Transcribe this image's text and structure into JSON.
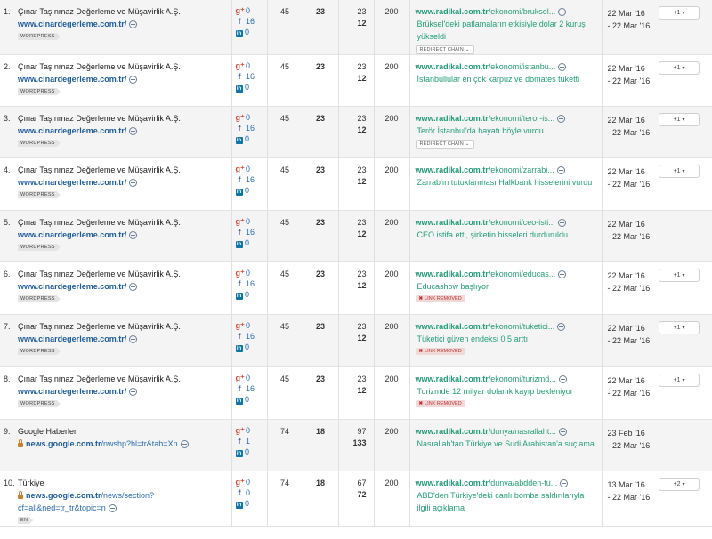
{
  "rows": [
    {
      "num": "1.",
      "title": "Çınar Taşınmaz Değerleme ve Müşavirlik A.Ş.",
      "domain": "www.cinardegerleme.com.tr/",
      "path": "",
      "tag": "WORDPRESS",
      "lock": false,
      "gplus": "0",
      "fb": "16",
      "li": "0",
      "n1": "45",
      "n2": "23",
      "n3a": "23",
      "n3b": "12",
      "code": "200",
      "tdomain": "www.radikal.com.tr",
      "tpath": "/ekonomi/bruksel...",
      "anchor": "Brüksel'deki patlamaların etkisiyle dolar 2 kuruş yükseldi",
      "chip": "REDIRECT CHAIN",
      "chip_arrow": "⌄",
      "removed": "",
      "date1": "22 Mar '16",
      "date2": "- 22 Mar '16",
      "vote": "+1"
    },
    {
      "num": "2.",
      "title": "Çınar Taşınmaz Değerleme ve Müşavirlik A.Ş.",
      "domain": "www.cinardegerleme.com.tr/",
      "path": "",
      "tag": "WORDPRESS",
      "lock": false,
      "gplus": "0",
      "fb": "16",
      "li": "0",
      "n1": "45",
      "n2": "23",
      "n3a": "23",
      "n3b": "12",
      "code": "200",
      "tdomain": "www.radikal.com.tr",
      "tpath": "/ekonomi/istanbu...",
      "anchor": "İstanbullular en çok karpuz ve domates tüketti",
      "chip": "",
      "removed": "",
      "date1": "22 Mar '16",
      "date2": "- 22 Mar '16",
      "vote": "+1"
    },
    {
      "num": "3.",
      "title": "Çınar Taşınmaz Değerleme ve Müşavirlik A.Ş.",
      "domain": "www.cinardegerleme.com.tr/",
      "path": "",
      "tag": "WORDPRESS",
      "lock": false,
      "gplus": "0",
      "fb": "16",
      "li": "0",
      "n1": "45",
      "n2": "23",
      "n3a": "23",
      "n3b": "12",
      "code": "200",
      "tdomain": "www.radikal.com.tr",
      "tpath": "/ekonomi/teror-is...",
      "anchor": "Terör İstanbul'da hayatı böyle vurdu",
      "chip": "REDIRECT CHAIN",
      "chip_arrow": "⌄",
      "removed": "",
      "date1": "22 Mar '16",
      "date2": "- 22 Mar '16",
      "vote": "+1"
    },
    {
      "num": "4.",
      "title": "Çınar Taşınmaz Değerleme ve Müşavirlik A.Ş.",
      "domain": "www.cinardegerleme.com.tr/",
      "path": "",
      "tag": "WORDPRESS",
      "lock": false,
      "gplus": "0",
      "fb": "16",
      "li": "0",
      "n1": "45",
      "n2": "23",
      "n3a": "23",
      "n3b": "12",
      "code": "200",
      "tdomain": "www.radikal.com.tr",
      "tpath": "/ekonomi/zarrabi...",
      "anchor": "Zarrab'ın tutuklanması Halkbank hisselerini vurdu",
      "chip": "",
      "removed": "",
      "date1": "22 Mar '16",
      "date2": "- 22 Mar '16",
      "vote": "+1"
    },
    {
      "num": "5.",
      "title": "Çınar Taşınmaz Değerleme ve Müşavirlik A.Ş.",
      "domain": "www.cinardegerleme.com.tr/",
      "path": "",
      "tag": "WORDPRESS",
      "lock": false,
      "gplus": "0",
      "fb": "16",
      "li": "0",
      "n1": "45",
      "n2": "23",
      "n3a": "23",
      "n3b": "12",
      "code": "200",
      "tdomain": "www.radikal.com.tr",
      "tpath": "/ekonomi/ceo-isti...",
      "anchor": "CEO istifa etti, şirketin hisseleri durduruldu",
      "chip": "",
      "removed": "",
      "date1": "22 Mar '16",
      "date2": "- 22 Mar '16",
      "vote": ""
    },
    {
      "num": "6.",
      "title": "Çınar Taşınmaz Değerleme ve Müşavirlik A.Ş.",
      "domain": "www.cinardegerleme.com.tr/",
      "path": "",
      "tag": "WORDPRESS",
      "lock": false,
      "gplus": "0",
      "fb": "16",
      "li": "0",
      "n1": "45",
      "n2": "23",
      "n3a": "23",
      "n3b": "12",
      "code": "200",
      "tdomain": "www.radikal.com.tr",
      "tpath": "/ekonomi/educas...",
      "anchor": "Educashow başlıyor",
      "chip": "",
      "removed": "LINK REMOVED",
      "date1": "22 Mar '16",
      "date2": "- 22 Mar '16",
      "vote": "+1"
    },
    {
      "num": "7.",
      "title": "Çınar Taşınmaz Değerleme ve Müşavirlik A.Ş.",
      "domain": "www.cinardegerleme.com.tr/",
      "path": "",
      "tag": "WORDPRESS",
      "lock": false,
      "gplus": "0",
      "fb": "16",
      "li": "0",
      "n1": "45",
      "n2": "23",
      "n3a": "23",
      "n3b": "12",
      "code": "200",
      "tdomain": "www.radikal.com.tr",
      "tpath": "/ekonomi/tuketici...",
      "anchor": "Tüketici güven endeksi 0.5 arttı",
      "chip": "",
      "removed": "LINK REMOVED",
      "date1": "22 Mar '16",
      "date2": "- 22 Mar '16",
      "vote": "+1"
    },
    {
      "num": "8.",
      "title": "Çınar Taşınmaz Değerleme ve Müşavirlik A.Ş.",
      "domain": "www.cinardegerleme.com.tr/",
      "path": "",
      "tag": "WORDPRESS",
      "lock": false,
      "gplus": "0",
      "fb": "16",
      "li": "0",
      "n1": "45",
      "n2": "23",
      "n3a": "23",
      "n3b": "12",
      "code": "200",
      "tdomain": "www.radikal.com.tr",
      "tpath": "/ekonomi/turizmd...",
      "anchor": "Turizmde 12 milyar dolarlık kayıp bekleniyor",
      "chip": "",
      "removed": "LINK REMOVED",
      "date1": "22 Mar '16",
      "date2": "- 22 Mar '16",
      "vote": "+1"
    },
    {
      "num": "9.",
      "title": "Google Haberler",
      "domain": "news.google.com.tr",
      "path": "/nwshp?hl=tr&tab=Xn",
      "tag": "",
      "lock": true,
      "gplus": "0",
      "fb": "1",
      "li": "0",
      "n1": "74",
      "n2": "18",
      "n3a": "97",
      "n3b": "133",
      "code": "200",
      "tdomain": "www.radikal.com.tr",
      "tpath": "/dunya/nasrallaht...",
      "anchor": "Nasrallah'tan Türkiye ve Sudi Arabistan'a suçlama",
      "chip": "",
      "removed": "",
      "date1": "23 Feb '16",
      "date2": "- 22 Mar '16",
      "vote": ""
    },
    {
      "num": "10.",
      "title": "Türkiye",
      "domain": "news.google.com.tr",
      "path": "/news/section?cf=all&ned=tr_tr&topic=n",
      "tag": "EN",
      "lock": true,
      "gplus": "0",
      "fb": "0",
      "li": "0",
      "n1": "74",
      "n2": "18",
      "n3a": "67",
      "n3b": "72",
      "code": "200",
      "tdomain": "www.radikal.com.tr",
      "tpath": "/dunya/abdden-tu...",
      "anchor": "ABD'den Türkiye'deki canlı bomba saldırılarıyla ilgili açıklama",
      "chip": "",
      "removed": "",
      "date1": "13 Mar '16",
      "date2": "- 22 Mar '16",
      "vote": "+2"
    }
  ]
}
